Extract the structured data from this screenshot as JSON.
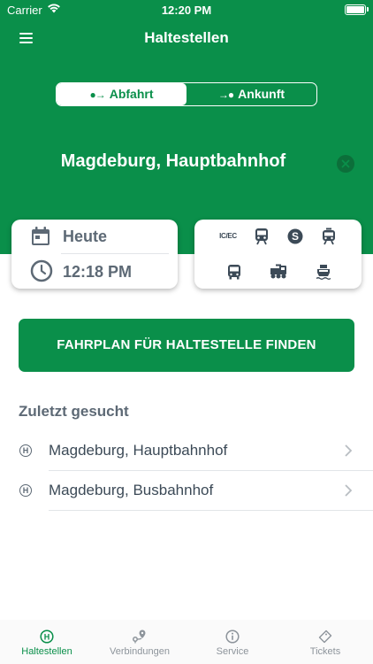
{
  "status": {
    "carrier": "Carrier",
    "time": "12:20 PM"
  },
  "header": {
    "title": "Haltestellen",
    "menu_icon": "hamburger-menu-icon"
  },
  "direction": {
    "options": [
      {
        "label": "Abfahrt",
        "selected": true,
        "icon": "departure-icon"
      },
      {
        "label": "Ankunft",
        "selected": false,
        "icon": "arrival-icon"
      }
    ]
  },
  "station": {
    "name": "Magdeburg, Hauptbahnhof"
  },
  "datetime": {
    "date": "Heute",
    "time": "12:18 PM"
  },
  "modes": [
    {
      "name": "IC/EC",
      "icon": "intercity-icon"
    },
    {
      "name": "regional-train",
      "icon": "regional-train-icon"
    },
    {
      "name": "S-Bahn",
      "icon": "s-bahn-icon"
    },
    {
      "name": "tram",
      "icon": "tram-icon"
    },
    {
      "name": "bus",
      "icon": "bus-icon"
    },
    {
      "name": "heritage-train",
      "icon": "steam-train-icon"
    },
    {
      "name": "ferry",
      "icon": "ferry-icon"
    }
  ],
  "actions": {
    "find_label": "FAHRPLAN FÜR HALTESTELLE FINDEN"
  },
  "recent": {
    "heading": "Zuletzt gesucht",
    "items": [
      {
        "name": "Magdeburg, Hauptbahnhof"
      },
      {
        "name": "Magdeburg, Busbahnhof"
      }
    ]
  },
  "tabs": [
    {
      "label": "Haltestellen",
      "active": true
    },
    {
      "label": "Verbindungen",
      "active": false
    },
    {
      "label": "Service",
      "active": false
    },
    {
      "label": "Tickets",
      "active": false
    }
  ],
  "colors": {
    "brand": "#0a8f4a",
    "text": "#3c4a57",
    "muted": "#5d6975",
    "tab_inactive": "#8d949b"
  }
}
